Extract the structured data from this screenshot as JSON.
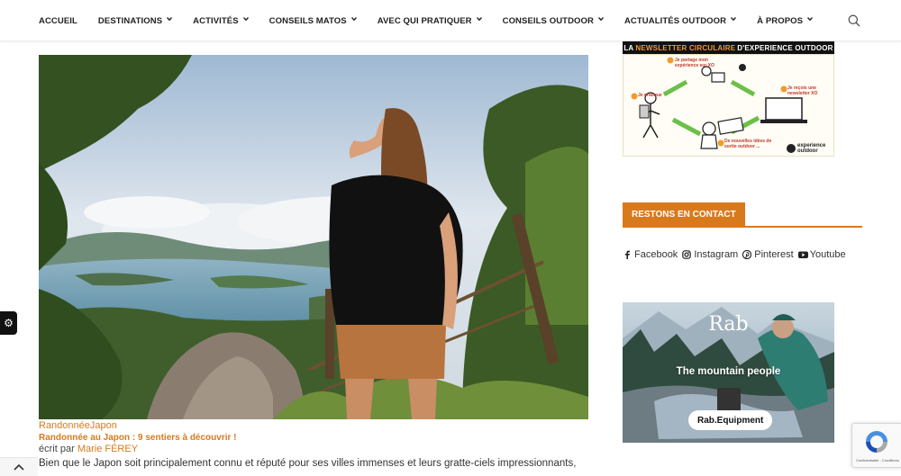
{
  "nav": {
    "items": [
      {
        "label": "ACCUEIL",
        "has_dropdown": false
      },
      {
        "label": "DESTINATIONS",
        "has_dropdown": true
      },
      {
        "label": "ACTIVITÉS",
        "has_dropdown": true
      },
      {
        "label": "CONSEILS MATOS",
        "has_dropdown": true
      },
      {
        "label": "AVEC QUI PRATIQUER",
        "has_dropdown": true
      },
      {
        "label": "CONSEILS OUTDOOR",
        "has_dropdown": true
      },
      {
        "label": "ACTUALITÉS OUTDOOR",
        "has_dropdown": true
      },
      {
        "label": "À PROPOS",
        "has_dropdown": true
      }
    ],
    "search_icon": "search-icon"
  },
  "post": {
    "categories": "RandonnéeJapon",
    "title": "Randonnée au Japon : 9 sentiers à découvrir !",
    "author_prefix": "écrit par",
    "author_name": "Marie FÉREY",
    "excerpt": "Bien que le Japon soit principalement connu et réputé pour ses villes immenses et leurs gratte-ciels impressionnants,"
  },
  "sidebar": {
    "newsletter": {
      "head_pre": "LA",
      "head_highlight": "NEWSLETTER CIRCULAIRE",
      "head_post": "D'EXPERIENCE OUTDOOR",
      "steps": [
        "Je pratique",
        "Je partage mon expérience sur XO",
        "Je reçois une newsletter XO",
        "De nouvelles idées de sortie outdoor ..."
      ],
      "logo_line1": "experience",
      "logo_line2": "outdoor"
    },
    "contact_title": "RESTONS EN CONTACT",
    "socials": [
      {
        "label": "Facebook",
        "icon": "facebook-icon"
      },
      {
        "label": "Instagram",
        "icon": "instagram-icon"
      },
      {
        "label": "Pinterest",
        "icon": "pinterest-icon"
      },
      {
        "label": "Youtube",
        "icon": "youtube-icon"
      }
    ],
    "ad": {
      "brand": "Rab",
      "tagline": "The mountain people",
      "cta": "Rab.Equipment"
    }
  },
  "widgets": {
    "cookie_icon": "gear-icon",
    "scroll_top_icon": "chevron-up-icon",
    "recaptcha_note": "Confidentialité - Conditions"
  },
  "colors": {
    "accent": "#d87a1c",
    "newsletter_highlight": "#f39a2b",
    "nav_text": "#222222"
  }
}
